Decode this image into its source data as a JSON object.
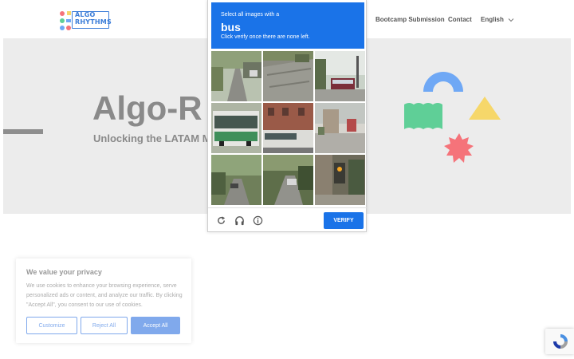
{
  "logo": {
    "text_line1": "ALGO",
    "text_line2": "RHYTHMS"
  },
  "nav": {
    "items": [
      {
        "label": "Bootcamp Submission"
      },
      {
        "label": "Contact"
      },
      {
        "label": "English"
      }
    ]
  },
  "hero": {
    "title": "Algo-R",
    "subtitle": "Unlocking the LATAM M"
  },
  "captcha": {
    "instruction": "Select all images with a",
    "target": "bus",
    "hint": "Click verify once there are none left.",
    "verify_label": "VERIFY",
    "icons": [
      "reload-icon",
      "audio-icon",
      "info-icon"
    ]
  },
  "cookie": {
    "title": "We value your privacy",
    "text": "We use cookies to enhance your browsing experience, serve personalized ads or content, and analyze our traffic. By clicking \"Accept All\", you consent to our use of cookies.",
    "customize_label": "Customize",
    "reject_label": "Reject All",
    "accept_label": "Accept All"
  },
  "colors": {
    "captcha_blue": "#1a73e8",
    "cookie_blue": "#1863dc",
    "hero_bg": "#ececec",
    "shape_blue": "#6fa8f5",
    "shape_green": "#5fcf97",
    "shape_yellow": "#f6d76a",
    "shape_red": "#f5737a"
  }
}
